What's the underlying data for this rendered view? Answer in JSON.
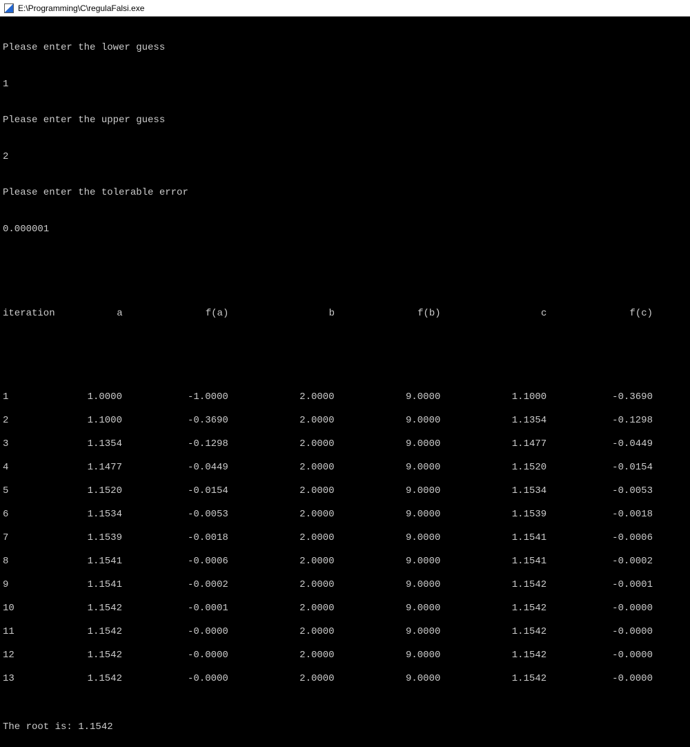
{
  "window": {
    "title": "E:\\Programming\\C\\regulaFalsi.exe"
  },
  "prompts": {
    "lower_label": "Please enter the lower guess",
    "lower_value": "1",
    "upper_label": "Please enter the upper guess",
    "upper_value": "2",
    "tol_label": "Please enter the tolerable error",
    "tol_value": "0.000001"
  },
  "headers": {
    "iter": "iteration",
    "a": "a",
    "fa": "f(a)",
    "b": "b",
    "fb": "f(b)",
    "c": "c",
    "fc": "f(c)"
  },
  "rows": [
    {
      "iter": "1",
      "a": "1.0000",
      "fa": "-1.0000",
      "b": "2.0000",
      "fb": "9.0000",
      "c": "1.1000",
      "fc": "-0.3690"
    },
    {
      "iter": "2",
      "a": "1.1000",
      "fa": "-0.3690",
      "b": "2.0000",
      "fb": "9.0000",
      "c": "1.1354",
      "fc": "-0.1298"
    },
    {
      "iter": "3",
      "a": "1.1354",
      "fa": "-0.1298",
      "b": "2.0000",
      "fb": "9.0000",
      "c": "1.1477",
      "fc": "-0.0449"
    },
    {
      "iter": "4",
      "a": "1.1477",
      "fa": "-0.0449",
      "b": "2.0000",
      "fb": "9.0000",
      "c": "1.1520",
      "fc": "-0.0154"
    },
    {
      "iter": "5",
      "a": "1.1520",
      "fa": "-0.0154",
      "b": "2.0000",
      "fb": "9.0000",
      "c": "1.1534",
      "fc": "-0.0053"
    },
    {
      "iter": "6",
      "a": "1.1534",
      "fa": "-0.0053",
      "b": "2.0000",
      "fb": "9.0000",
      "c": "1.1539",
      "fc": "-0.0018"
    },
    {
      "iter": "7",
      "a": "1.1539",
      "fa": "-0.0018",
      "b": "2.0000",
      "fb": "9.0000",
      "c": "1.1541",
      "fc": "-0.0006"
    },
    {
      "iter": "8",
      "a": "1.1541",
      "fa": "-0.0006",
      "b": "2.0000",
      "fb": "9.0000",
      "c": "1.1541",
      "fc": "-0.0002"
    },
    {
      "iter": "9",
      "a": "1.1541",
      "fa": "-0.0002",
      "b": "2.0000",
      "fb": "9.0000",
      "c": "1.1542",
      "fc": "-0.0001"
    },
    {
      "iter": "10",
      "a": "1.1542",
      "fa": "-0.0001",
      "b": "2.0000",
      "fb": "9.0000",
      "c": "1.1542",
      "fc": "-0.0000"
    },
    {
      "iter": "11",
      "a": "1.1542",
      "fa": "-0.0000",
      "b": "2.0000",
      "fb": "9.0000",
      "c": "1.1542",
      "fc": "-0.0000"
    },
    {
      "iter": "12",
      "a": "1.1542",
      "fa": "-0.0000",
      "b": "2.0000",
      "fb": "9.0000",
      "c": "1.1542",
      "fc": "-0.0000"
    },
    {
      "iter": "13",
      "a": "1.1542",
      "fa": "-0.0000",
      "b": "2.0000",
      "fb": "9.0000",
      "c": "1.1542",
      "fc": "-0.0000"
    }
  ],
  "result": "The root is: 1.1542"
}
